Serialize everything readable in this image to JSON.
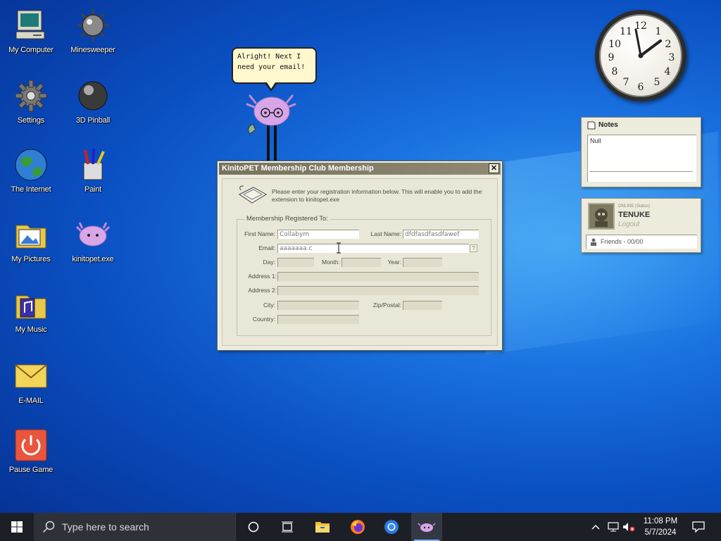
{
  "desktop": {
    "icons": [
      {
        "label": "My Computer"
      },
      {
        "label": "Minesweeper"
      },
      {
        "label": "Settings"
      },
      {
        "label": "3D Pinball"
      },
      {
        "label": "The Internet"
      },
      {
        "label": "Paint"
      },
      {
        "label": "My Pictures"
      },
      {
        "label": "kinitopet.exe"
      },
      {
        "label": "My Music"
      },
      {
        "label": "E-MAIL"
      },
      {
        "label": "Pause Game"
      }
    ]
  },
  "pet": {
    "speech": "Alright! Next I need your email!"
  },
  "dialog": {
    "title": "KinitoPET Membership Club Membership",
    "close": "✕",
    "intro": "Please enter your registration information below. This will enable you to add the extension to kinitopet.exe",
    "group_title": "Membership Registered To:",
    "labels": {
      "first_name": "First Name:",
      "last_name": "Last Name:",
      "email": "Email:",
      "day": "Day:",
      "month": "Month:",
      "year": "Year:",
      "address1": "Address 1:",
      "address2": "Address 2:",
      "city": "City:",
      "zip": "Zip/Postal:",
      "country": "Country:"
    },
    "values": {
      "first_name": "Collabym",
      "last_name": "dfdfasdfasdfawef",
      "email": "aaaaaaa.c",
      "help": "?"
    }
  },
  "widgets": {
    "notes": {
      "title": "Notes",
      "content": "Null"
    },
    "profile": {
      "status": "ONLINE (Status)",
      "name": "TENUKE",
      "logout": "Logout",
      "friends": "Friends - 00/00"
    },
    "clock_numbers": [
      "12",
      "1",
      "2",
      "3",
      "4",
      "5",
      "6",
      "7",
      "8",
      "9",
      "10",
      "11"
    ]
  },
  "taskbar": {
    "search_placeholder": "Type here to search",
    "time": "11:08 PM",
    "date": "5/7/2024"
  },
  "colors": {
    "desktop_blue": "#0a4fc2",
    "dialog_bg": "#ecebdc",
    "titlebar": "#77735d",
    "taskbar": "#1c1f25"
  }
}
